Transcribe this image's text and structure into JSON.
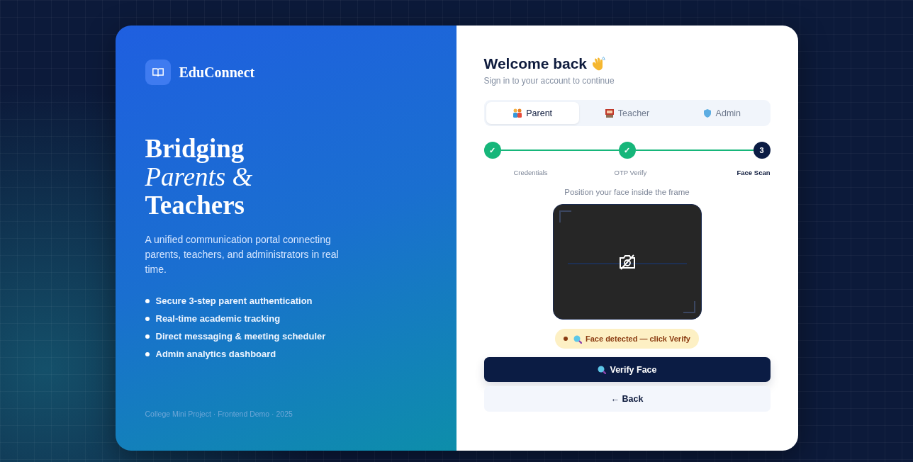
{
  "brand": {
    "name": "EduConnect"
  },
  "hero": {
    "title_lines": [
      {
        "text": "Bridging",
        "italic": false
      },
      {
        "text": "Parents &",
        "italic": true
      },
      {
        "text": "Teachers",
        "italic": false
      }
    ],
    "description": "A unified communication portal connecting parents, teachers, and administrators in real time.",
    "features": [
      "Secure 3-step parent authentication",
      "Real-time academic tracking",
      "Direct messaging & meeting scheduler",
      "Admin analytics dashboard"
    ],
    "footer": "College Mini Project · Frontend Demo · 2025"
  },
  "login": {
    "title": "Welcome back",
    "subtitle": "Sign in to your account to continue",
    "tabs": [
      {
        "label": "Parent",
        "kind": "family",
        "selected": true
      },
      {
        "label": "Teacher",
        "kind": "board",
        "selected": false
      },
      {
        "label": "Admin",
        "kind": "shield",
        "selected": false
      }
    ],
    "steps": [
      {
        "label": "Credentials",
        "done": true,
        "selected": false,
        "number": "✓"
      },
      {
        "label": "OTP Verify",
        "done": true,
        "selected": false,
        "number": "✓"
      },
      {
        "label": "Face Scan",
        "done": false,
        "selected": true,
        "number": "3"
      }
    ],
    "scan_hint": "Position your face inside the frame",
    "status": "Face detected — click Verify",
    "verify_button": "Verify Face",
    "back_button": "← Back"
  }
}
